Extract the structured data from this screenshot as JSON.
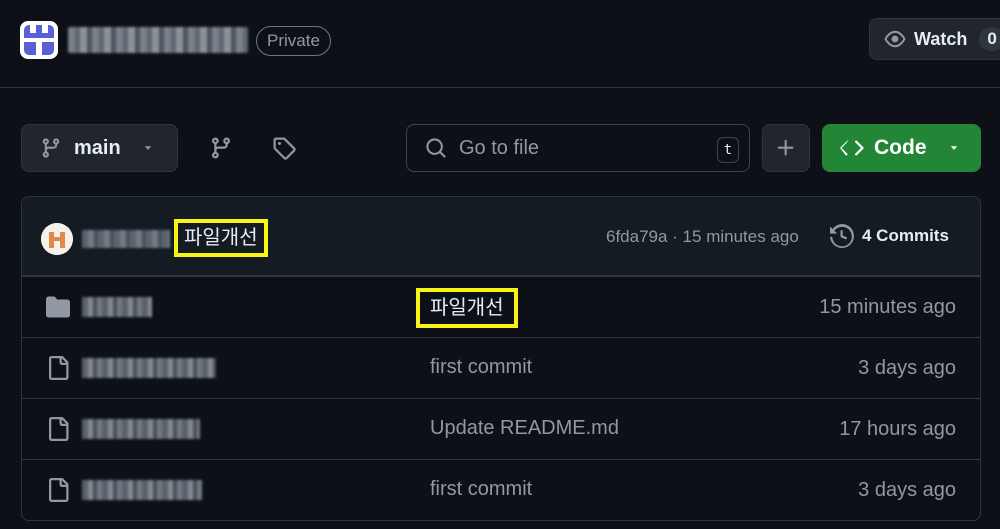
{
  "header": {
    "visibility_badge": "Private",
    "watch": {
      "label": "Watch",
      "count": "0"
    }
  },
  "toolbar": {
    "branch": "main",
    "search_placeholder": "Go to file",
    "search_shortcut": "t",
    "code_label": "Code"
  },
  "latest_commit": {
    "message": "파일개선",
    "meta": "6fda79a · 15 minutes ago",
    "commits_label": "4 Commits"
  },
  "files": [
    {
      "type": "folder",
      "commit_message": "파일개선",
      "age": "15 minutes ago",
      "highlighted": true
    },
    {
      "type": "file",
      "commit_message": "first commit",
      "age": "3 days ago"
    },
    {
      "type": "file",
      "commit_message": "Update README.md",
      "age": "17 hours ago"
    },
    {
      "type": "file",
      "commit_message": "first commit",
      "age": "3 days ago"
    }
  ],
  "colors": {
    "background": "#0d1117",
    "code_button": "#238636",
    "highlight_border": "#f7f416"
  }
}
